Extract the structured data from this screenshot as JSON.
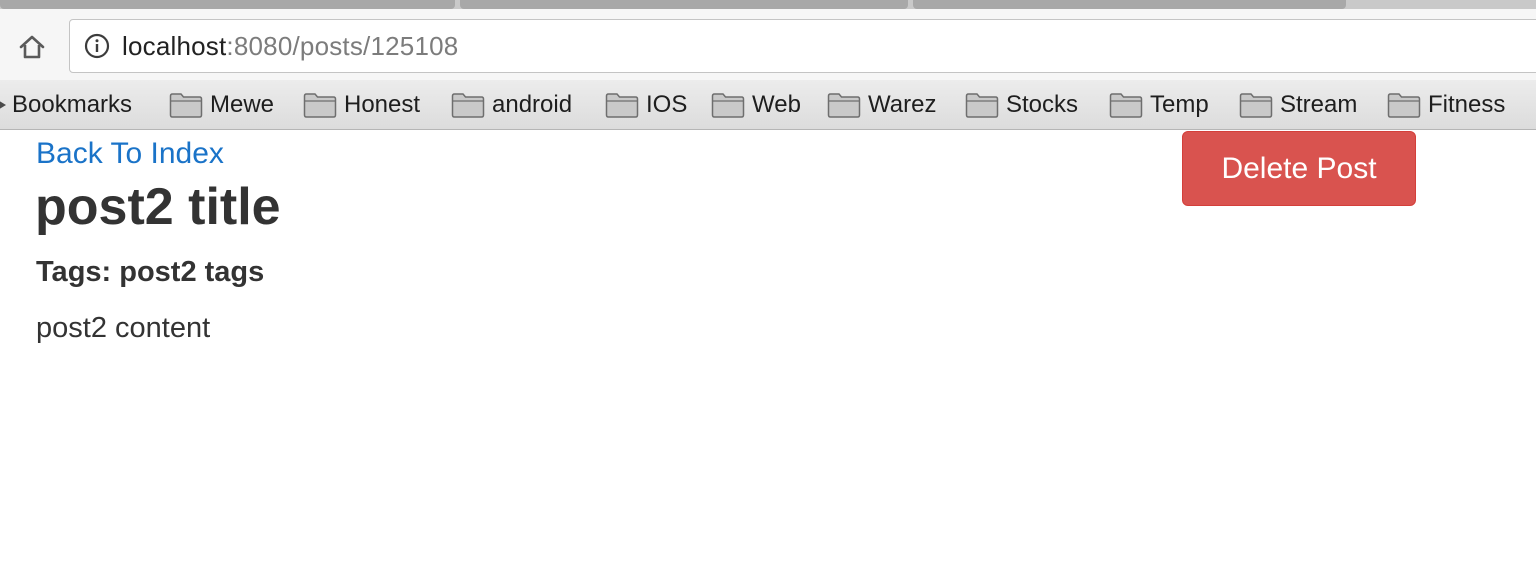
{
  "browser": {
    "address_bar": {
      "host": "localhost",
      "path": ":8080/posts/125108"
    },
    "icons": {
      "home": "home-icon",
      "info": "info-icon",
      "folder": "folder-icon"
    },
    "bookmarks": [
      {
        "label": "Bookmarks",
        "icon": "chevron-icon"
      },
      {
        "label": "Mewe",
        "icon": "folder-icon"
      },
      {
        "label": "Honest",
        "icon": "folder-icon"
      },
      {
        "label": "android",
        "icon": "folder-icon"
      },
      {
        "label": "IOS",
        "icon": "folder-icon"
      },
      {
        "label": "Web",
        "icon": "folder-icon"
      },
      {
        "label": "Warez",
        "icon": "folder-icon"
      },
      {
        "label": "Stocks",
        "icon": "folder-icon"
      },
      {
        "label": "Temp",
        "icon": "folder-icon"
      },
      {
        "label": "Stream",
        "icon": "folder-icon"
      },
      {
        "label": "Fitness",
        "icon": "folder-icon"
      }
    ]
  },
  "page": {
    "back_link": "Back To Index",
    "title": "post2 title",
    "tags": "Tags: post2 tags",
    "content": "post2 content",
    "delete_button": "Delete Post"
  },
  "colors": {
    "link": "#1a73c8",
    "danger": "#d9534f",
    "text": "#333333"
  }
}
